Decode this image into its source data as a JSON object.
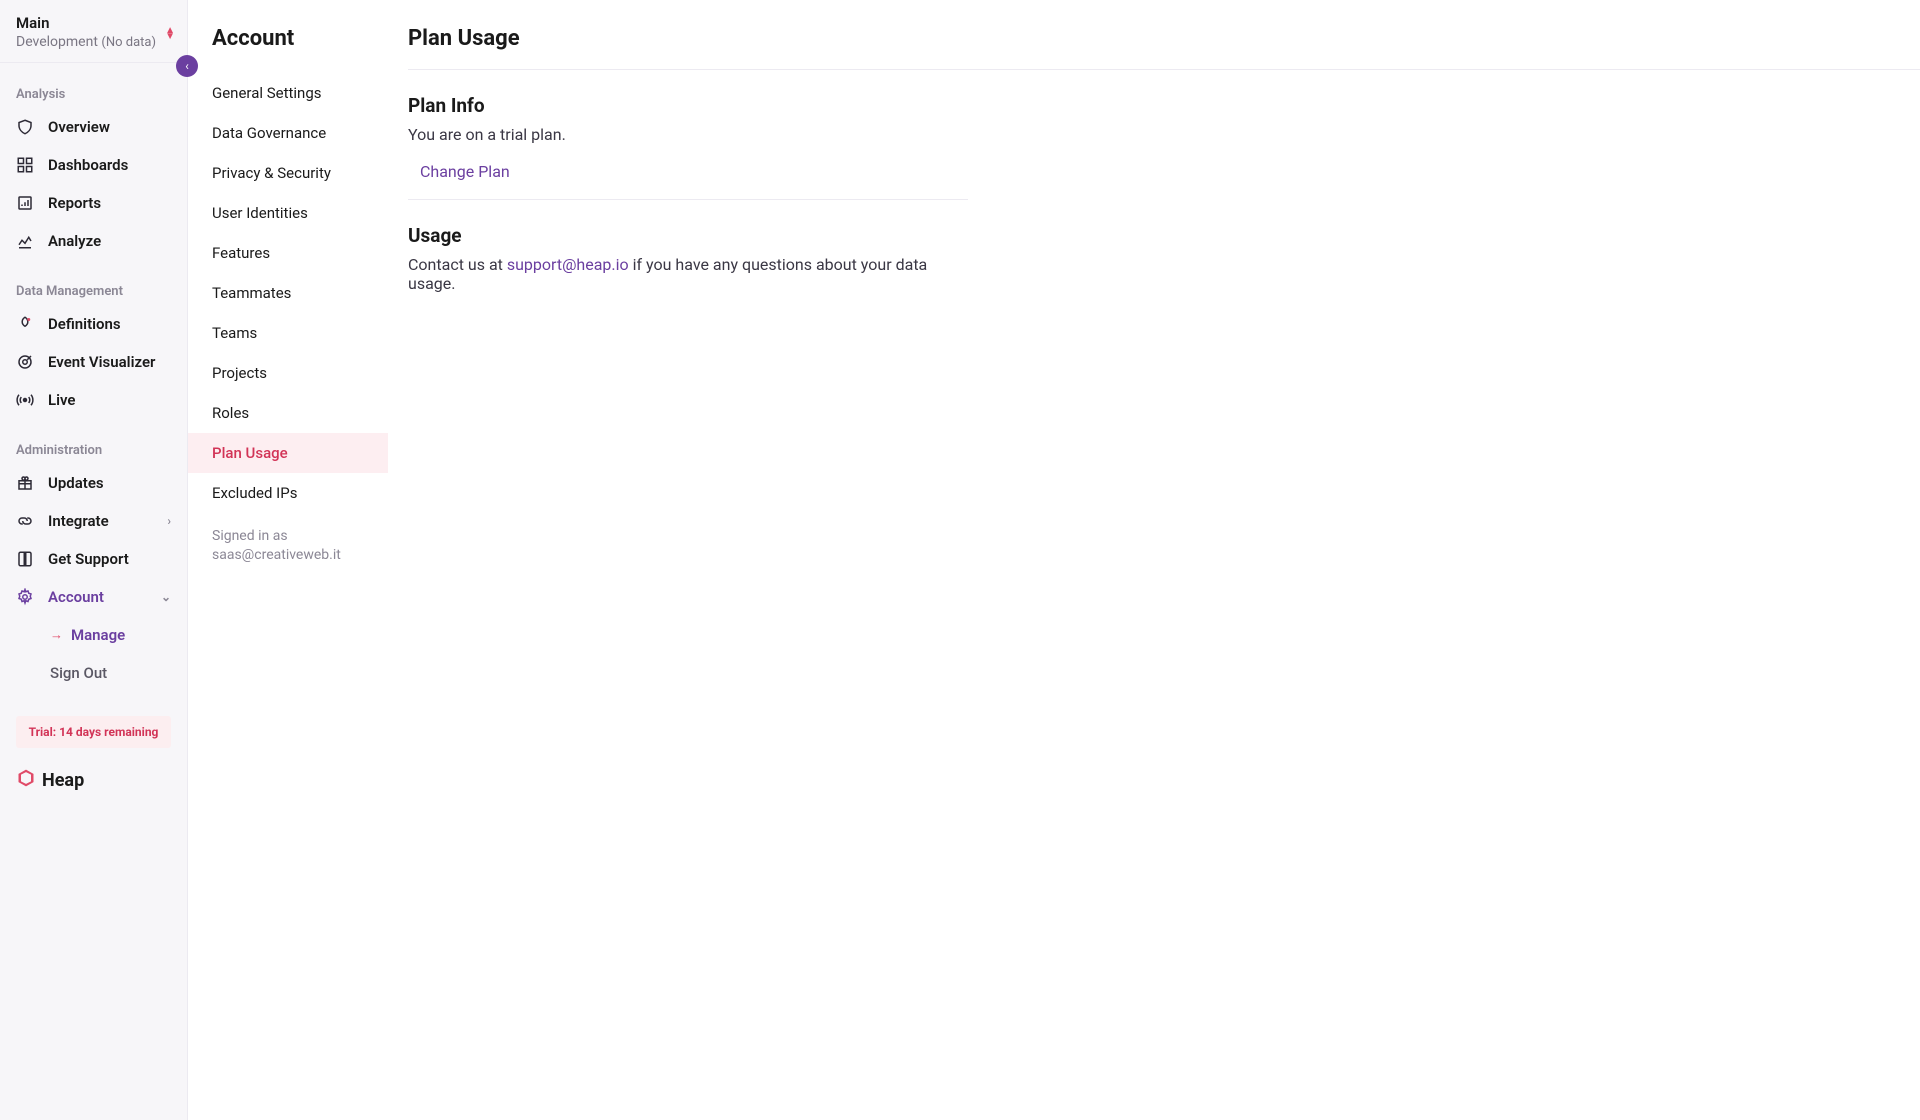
{
  "env": {
    "main": "Main",
    "sub": "Development",
    "status": "(No data)"
  },
  "nav": {
    "section_analysis": "Analysis",
    "overview": "Overview",
    "dashboards": "Dashboards",
    "reports": "Reports",
    "analyze": "Analyze",
    "section_data": "Data Management",
    "definitions": "Definitions",
    "event_visualizer": "Event Visualizer",
    "live": "Live",
    "section_admin": "Administration",
    "updates": "Updates",
    "integrate": "Integrate",
    "get_support": "Get Support",
    "account": "Account",
    "account_manage": "Manage",
    "account_signout": "Sign Out"
  },
  "trial_banner": "Trial: 14 days remaining",
  "brand": "Heap",
  "account_col": {
    "title": "Account",
    "items": [
      "General Settings",
      "Data Governance",
      "Privacy & Security",
      "User Identities",
      "Features",
      "Teammates",
      "Teams",
      "Projects",
      "Roles",
      "Plan Usage",
      "Excluded IPs"
    ],
    "active_index": 9,
    "signed_in_label": "Signed in as",
    "signed_in_email": "saas@creativeweb.it"
  },
  "page": {
    "title": "Plan Usage",
    "plan_info": {
      "heading": "Plan Info",
      "body": "You are on a trial plan.",
      "change_plan": "Change Plan"
    },
    "usage": {
      "heading": "Usage",
      "prefix": "Contact us at ",
      "email": "support@heap.io",
      "suffix": " if you have any questions about your data usage."
    }
  }
}
